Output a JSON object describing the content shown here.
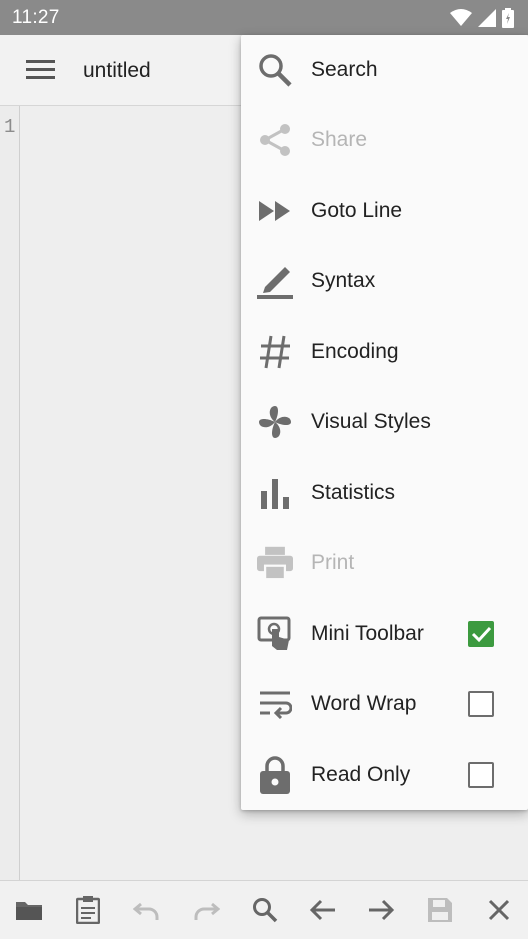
{
  "status_bar": {
    "time": "11:27"
  },
  "app_bar": {
    "title": "untitled"
  },
  "editor": {
    "line_numbers": [
      "1"
    ]
  },
  "menu": {
    "items": [
      {
        "label": "Search",
        "icon": "search-icon",
        "enabled": true
      },
      {
        "label": "Share",
        "icon": "share-icon",
        "enabled": false
      },
      {
        "label": "Goto Line",
        "icon": "fast-forward-icon",
        "enabled": true
      },
      {
        "label": "Syntax",
        "icon": "highlighter-icon",
        "enabled": true
      },
      {
        "label": "Encoding",
        "icon": "hash-icon",
        "enabled": true
      },
      {
        "label": "Visual Styles",
        "icon": "pinwheel-icon",
        "enabled": true
      },
      {
        "label": "Statistics",
        "icon": "bar-chart-icon",
        "enabled": true
      },
      {
        "label": "Print",
        "icon": "printer-icon",
        "enabled": false
      },
      {
        "label": "Mini Toolbar",
        "icon": "touch-screen-icon",
        "enabled": true,
        "checked": true
      },
      {
        "label": "Word Wrap",
        "icon": "word-wrap-icon",
        "enabled": true,
        "checked": false
      },
      {
        "label": "Read Only",
        "icon": "lock-icon",
        "enabled": true,
        "checked": false
      }
    ]
  },
  "toolbar": {
    "buttons": [
      "folder-icon",
      "clipboard-icon",
      "undo-icon",
      "redo-icon",
      "search-icon",
      "arrow-left-icon",
      "arrow-right-icon",
      "save-icon",
      "close-icon"
    ]
  },
  "colors": {
    "accent": "#3c9a3f",
    "status_bar": "#8a8a8a",
    "icon": "#6d6d6d",
    "disabled": "#b5b5b5"
  }
}
